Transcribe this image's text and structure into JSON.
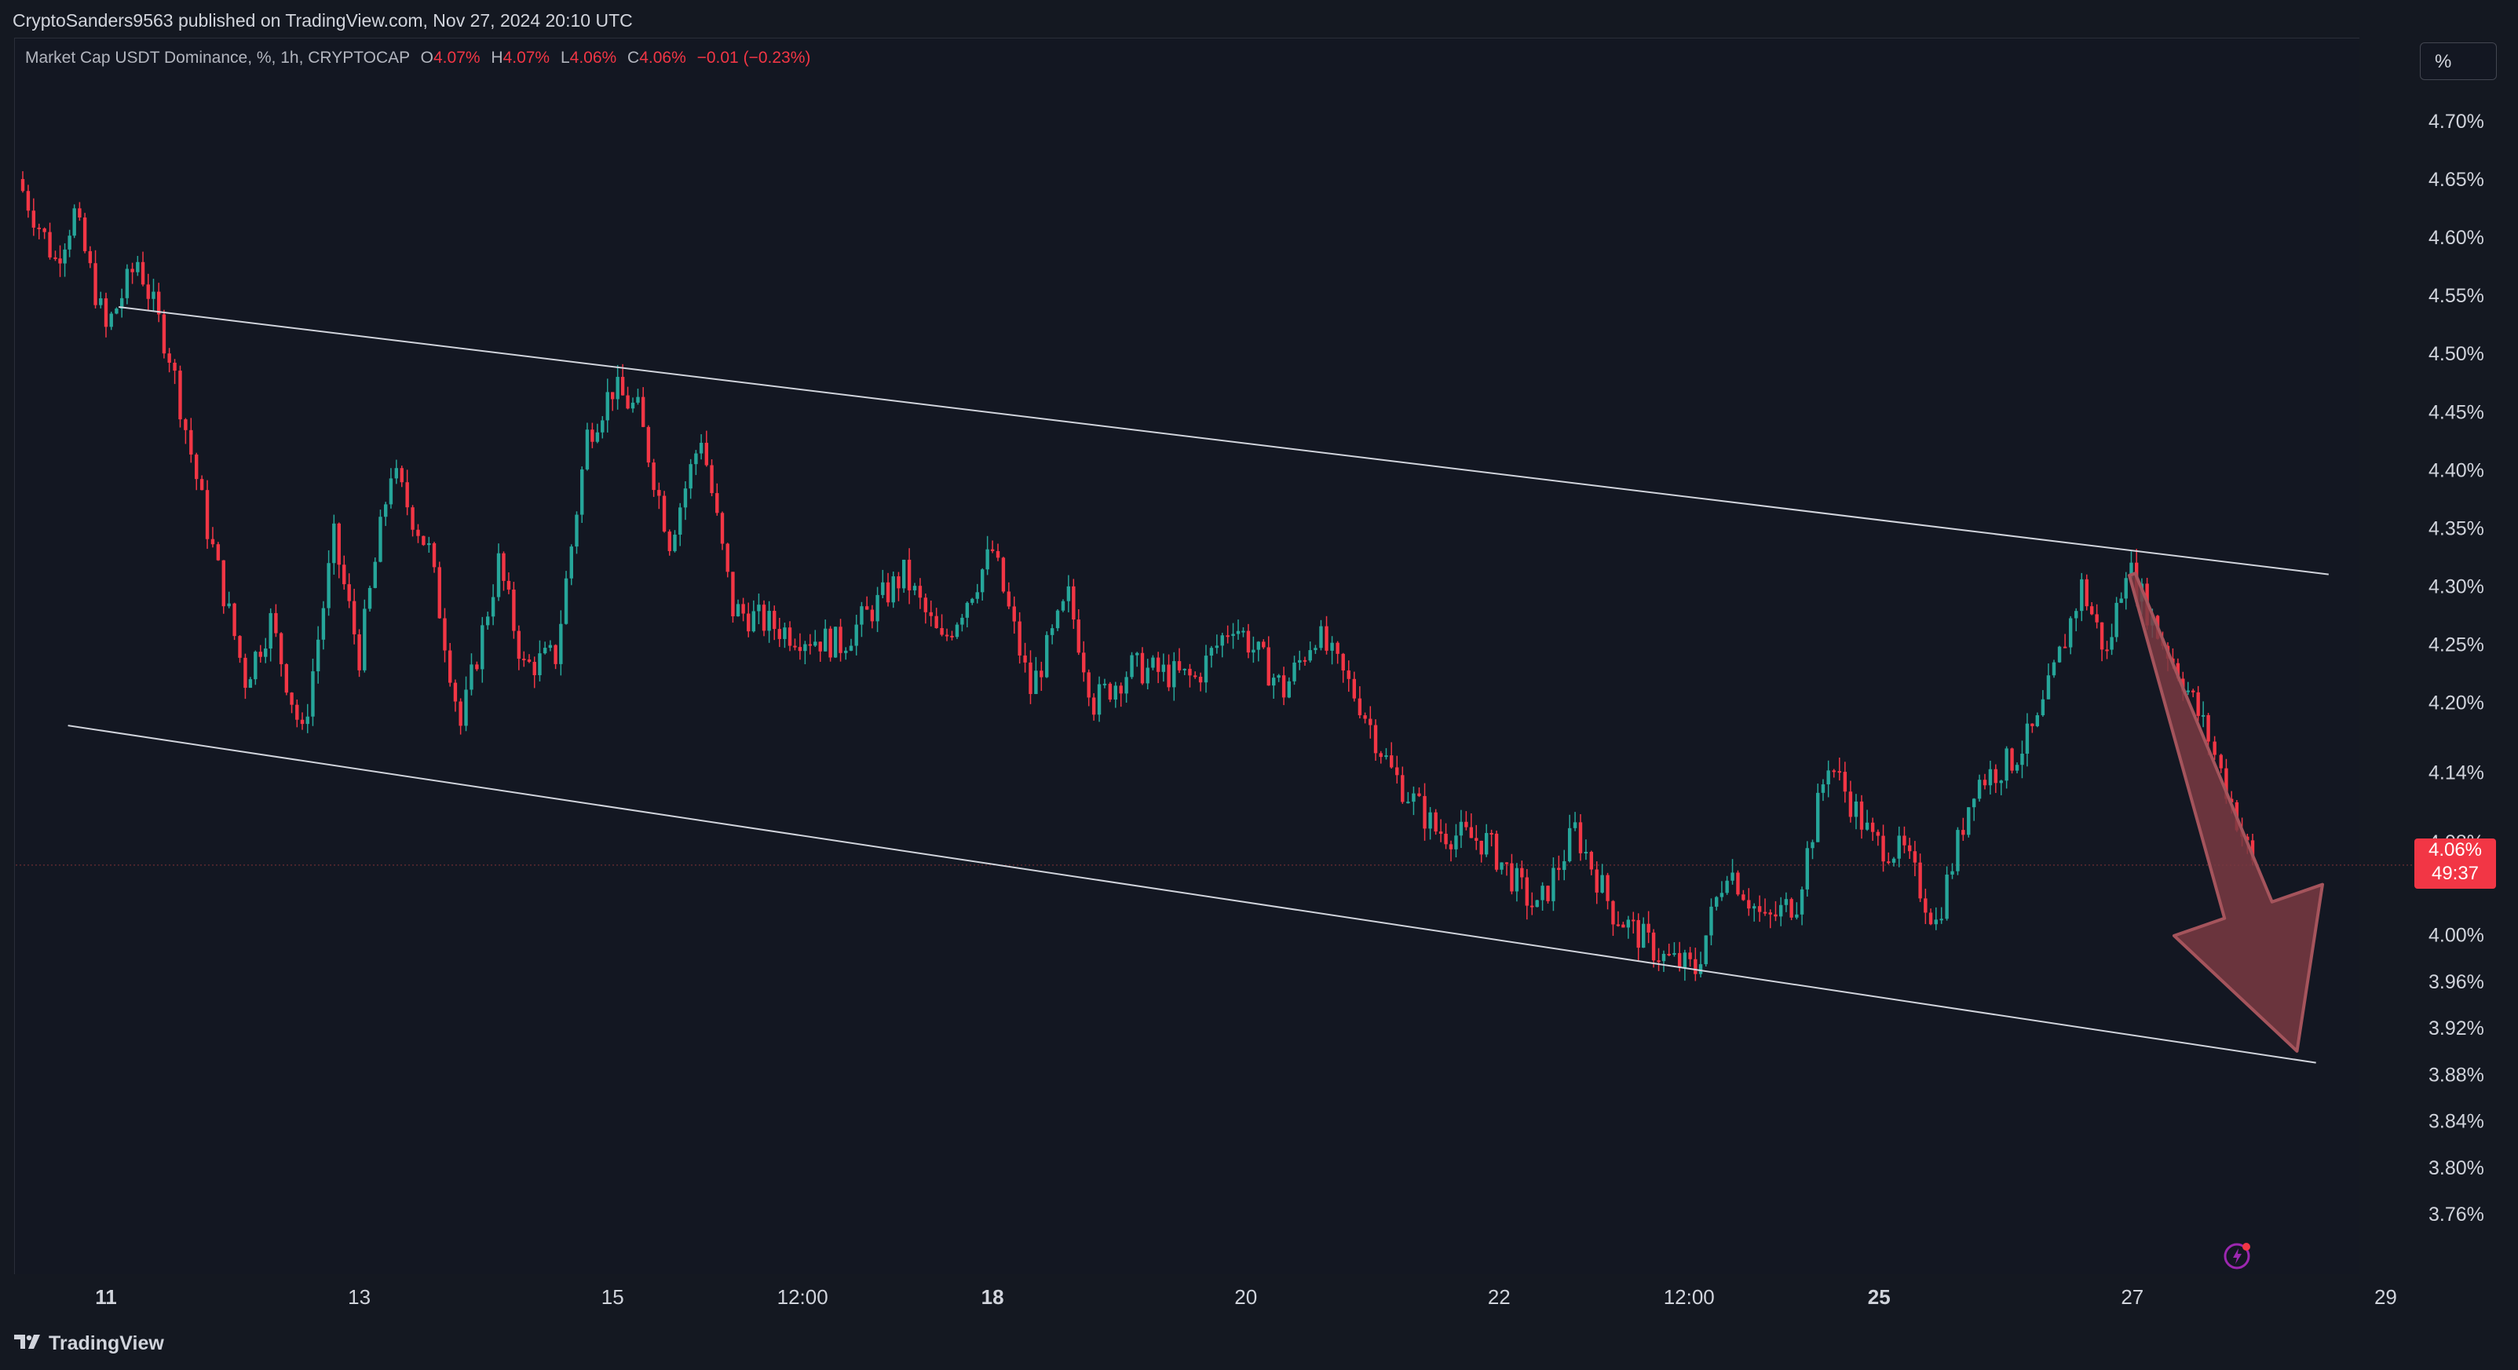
{
  "header": {
    "published_text": "CryptoSanders9563 published on TradingView.com, Nov 27, 2024 20:10 UTC"
  },
  "legend": {
    "symbol": "Market Cap USDT Dominance, %, 1h, CRYPTOCAP",
    "o_label": "O",
    "o_value": "4.07%",
    "h_label": "H",
    "h_value": "4.07%",
    "l_label": "L",
    "l_value": "4.06%",
    "c_label": "C",
    "c_value": "4.06%",
    "change": "−0.01 (−0.23%)"
  },
  "toolbar": {
    "scale_button": "%"
  },
  "price_tag": {
    "price": "4.06%",
    "countdown": "49:37"
  },
  "branding": {
    "logo_text": "TradingView"
  },
  "colors": {
    "background": "#131722",
    "up": "#26a69a",
    "down": "#f23645",
    "channel_line": "#d1d4dc",
    "arrow_fill": "#7a3a42",
    "arrow_stroke": "#a5545c"
  },
  "icons": {
    "logo": "tradingview-logo-icon",
    "alert": "lightning-alert-icon"
  },
  "chart_data": {
    "type": "candlestick",
    "title": "Market Cap USDT Dominance",
    "y_unit": "%",
    "ylim": [
      3.73,
      4.74
    ],
    "y_ticks": [
      "4.70%",
      "4.65%",
      "4.60%",
      "4.55%",
      "4.50%",
      "4.45%",
      "4.40%",
      "4.35%",
      "4.30%",
      "4.25%",
      "4.20%",
      "4.14%",
      "4.08%",
      "4.00%",
      "3.96%",
      "3.92%",
      "3.88%",
      "3.84%",
      "3.80%",
      "3.76%"
    ],
    "y_tick_values": [
      4.7,
      4.65,
      4.6,
      4.55,
      4.5,
      4.45,
      4.4,
      4.35,
      4.3,
      4.25,
      4.2,
      4.14,
      4.08,
      4.0,
      3.96,
      3.92,
      3.88,
      3.84,
      3.8,
      3.76
    ],
    "x_ticks": [
      {
        "label": "11",
        "day": 11,
        "bold": true
      },
      {
        "label": "13",
        "day": 13,
        "bold": false
      },
      {
        "label": "15",
        "day": 15,
        "bold": false
      },
      {
        "label": "12:00",
        "day": 16.5,
        "bold": false
      },
      {
        "label": "18",
        "day": 18,
        "bold": true
      },
      {
        "label": "20",
        "day": 20,
        "bold": false
      },
      {
        "label": "22",
        "day": 22,
        "bold": false
      },
      {
        "label": "12:00",
        "day": 23.5,
        "bold": false
      },
      {
        "label": "25",
        "day": 25,
        "bold": true
      },
      {
        "label": "27",
        "day": 27,
        "bold": false
      },
      {
        "label": "29",
        "day": 29,
        "bold": false
      }
    ],
    "path_points": [
      {
        "day": 10.3,
        "price": 4.65
      },
      {
        "day": 10.6,
        "price": 4.58
      },
      {
        "day": 10.75,
        "price": 4.62
      },
      {
        "day": 11.0,
        "price": 4.52
      },
      {
        "day": 11.25,
        "price": 4.58
      },
      {
        "day": 11.5,
        "price": 4.5
      },
      {
        "day": 11.8,
        "price": 4.35
      },
      {
        "day": 12.1,
        "price": 4.22
      },
      {
        "day": 12.3,
        "price": 4.27
      },
      {
        "day": 12.55,
        "price": 4.17
      },
      {
        "day": 12.8,
        "price": 4.34
      },
      {
        "day": 13.0,
        "price": 4.24
      },
      {
        "day": 13.25,
        "price": 4.4
      },
      {
        "day": 13.55,
        "price": 4.33
      },
      {
        "day": 13.8,
        "price": 4.18
      },
      {
        "day": 14.1,
        "price": 4.32
      },
      {
        "day": 14.3,
        "price": 4.23
      },
      {
        "day": 14.55,
        "price": 4.24
      },
      {
        "day": 14.8,
        "price": 4.43
      },
      {
        "day": 15.0,
        "price": 4.47
      },
      {
        "day": 15.2,
        "price": 4.45
      },
      {
        "day": 15.45,
        "price": 4.34
      },
      {
        "day": 15.7,
        "price": 4.43
      },
      {
        "day": 15.95,
        "price": 4.28
      },
      {
        "day": 16.4,
        "price": 4.26
      },
      {
        "day": 16.8,
        "price": 4.25
      },
      {
        "day": 17.3,
        "price": 4.31
      },
      {
        "day": 17.6,
        "price": 4.25
      },
      {
        "day": 18.0,
        "price": 4.33
      },
      {
        "day": 18.3,
        "price": 4.21
      },
      {
        "day": 18.6,
        "price": 4.29
      },
      {
        "day": 18.8,
        "price": 4.2
      },
      {
        "day": 19.1,
        "price": 4.23
      },
      {
        "day": 19.6,
        "price": 4.22
      },
      {
        "day": 19.9,
        "price": 4.27
      },
      {
        "day": 20.3,
        "price": 4.21
      },
      {
        "day": 20.55,
        "price": 4.26
      },
      {
        "day": 20.9,
        "price": 4.2
      },
      {
        "day": 21.15,
        "price": 4.14
      },
      {
        "day": 21.5,
        "price": 4.09
      },
      {
        "day": 21.9,
        "price": 4.08
      },
      {
        "day": 22.3,
        "price": 4.02
      },
      {
        "day": 22.6,
        "price": 4.09
      },
      {
        "day": 22.9,
        "price": 4.02
      },
      {
        "day": 23.3,
        "price": 3.98
      },
      {
        "day": 23.55,
        "price": 3.97
      },
      {
        "day": 23.8,
        "price": 4.06
      },
      {
        "day": 24.1,
        "price": 4.01
      },
      {
        "day": 24.35,
        "price": 4.03
      },
      {
        "day": 24.6,
        "price": 4.15
      },
      {
        "day": 24.95,
        "price": 4.08
      },
      {
        "day": 25.2,
        "price": 4.07
      },
      {
        "day": 25.45,
        "price": 4.01
      },
      {
        "day": 25.75,
        "price": 4.13
      },
      {
        "day": 26.05,
        "price": 4.15
      },
      {
        "day": 26.25,
        "price": 4.18
      },
      {
        "day": 26.6,
        "price": 4.3
      },
      {
        "day": 26.8,
        "price": 4.24
      },
      {
        "day": 26.95,
        "price": 4.32
      },
      {
        "day": 27.2,
        "price": 4.26
      },
      {
        "day": 27.4,
        "price": 4.22
      },
      {
        "day": 27.6,
        "price": 4.17
      },
      {
        "day": 27.7,
        "price": 4.14
      },
      {
        "day": 27.95,
        "price": 4.06
      }
    ],
    "current_price": 4.06,
    "channel_upper": [
      {
        "day": 11.1,
        "price": 4.54
      },
      {
        "day": 28.55,
        "price": 4.31
      }
    ],
    "channel_lower": [
      {
        "day": 10.7,
        "price": 4.18
      },
      {
        "day": 28.45,
        "price": 3.89
      }
    ],
    "projection_arrow": {
      "from": {
        "day": 27.0,
        "price": 4.31
      },
      "to": {
        "day": 28.3,
        "price": 3.9
      }
    },
    "grid": false,
    "legend_placement": "top-left"
  }
}
